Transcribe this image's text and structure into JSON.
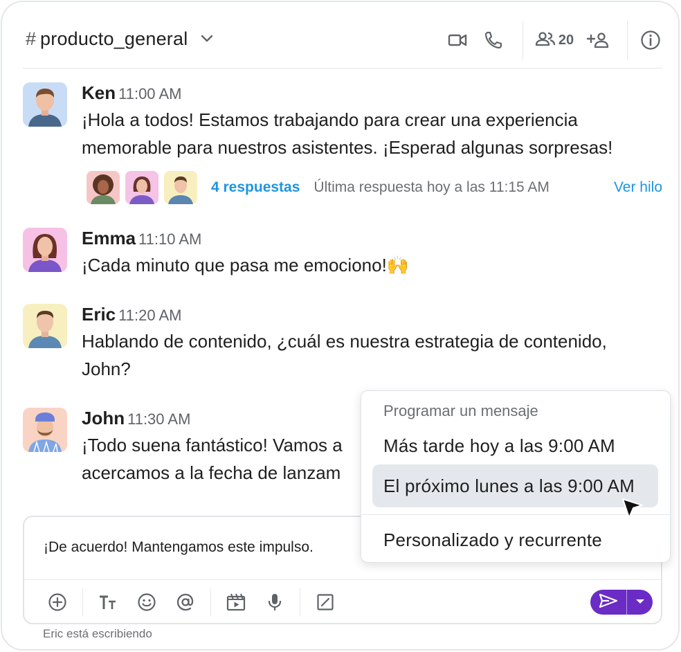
{
  "header": {
    "hash": "#",
    "channel": "producto_general",
    "members_count": "20",
    "icons": [
      "chevron-down-icon",
      "video-icon",
      "phone-icon",
      "members-icon",
      "add-member-icon",
      "info-icon"
    ]
  },
  "messages": [
    {
      "author": "Ken",
      "time": "11:00 AM",
      "lines": [
        "¡Hola a todos! Estamos trabajando para crear una experiencia",
        "memorable para nuestros asistentes. ¡Esperad algunas sorpresas!"
      ],
      "thread": {
        "replies": "4 respuestas",
        "last_reply": "Última respuesta hoy a las 11:15 AM",
        "view": "Ver hilo"
      }
    },
    {
      "author": "Emma",
      "time": "11:10 AM",
      "lines": [
        "¡Cada minuto que pasa me emociono!🙌"
      ]
    },
    {
      "author": "Eric",
      "time": "11:20 AM",
      "lines": [
        "Hablando de contenido, ¿cuál es nuestra estrategia de contenido,",
        "John?"
      ]
    },
    {
      "author": "John",
      "time": "11:30 AM",
      "lines": [
        "¡Todo suena fantástico! Vamos a",
        "acercamos a la fecha de lanzam"
      ]
    }
  ],
  "composer": {
    "value": "¡De acuerdo! Mantengamos este impulso.",
    "toolbar_icons": [
      "add-icon",
      "text-format-icon",
      "emoji-icon",
      "mention-icon",
      "media-icon",
      "microphone-icon",
      "slash-command-icon"
    ]
  },
  "schedule_menu": {
    "title": "Programar un mensaje",
    "items": [
      "Más tarde hoy a las 9:00 AM",
      "El próximo lunes a las 9:00 AM",
      "Personalizado y recurrente"
    ],
    "highlighted": 1
  },
  "typing": "Eric está escribiendo",
  "colors": {
    "accent": "#6a2cc5",
    "link": "#1e95e0",
    "border": "#e3e7ea"
  }
}
